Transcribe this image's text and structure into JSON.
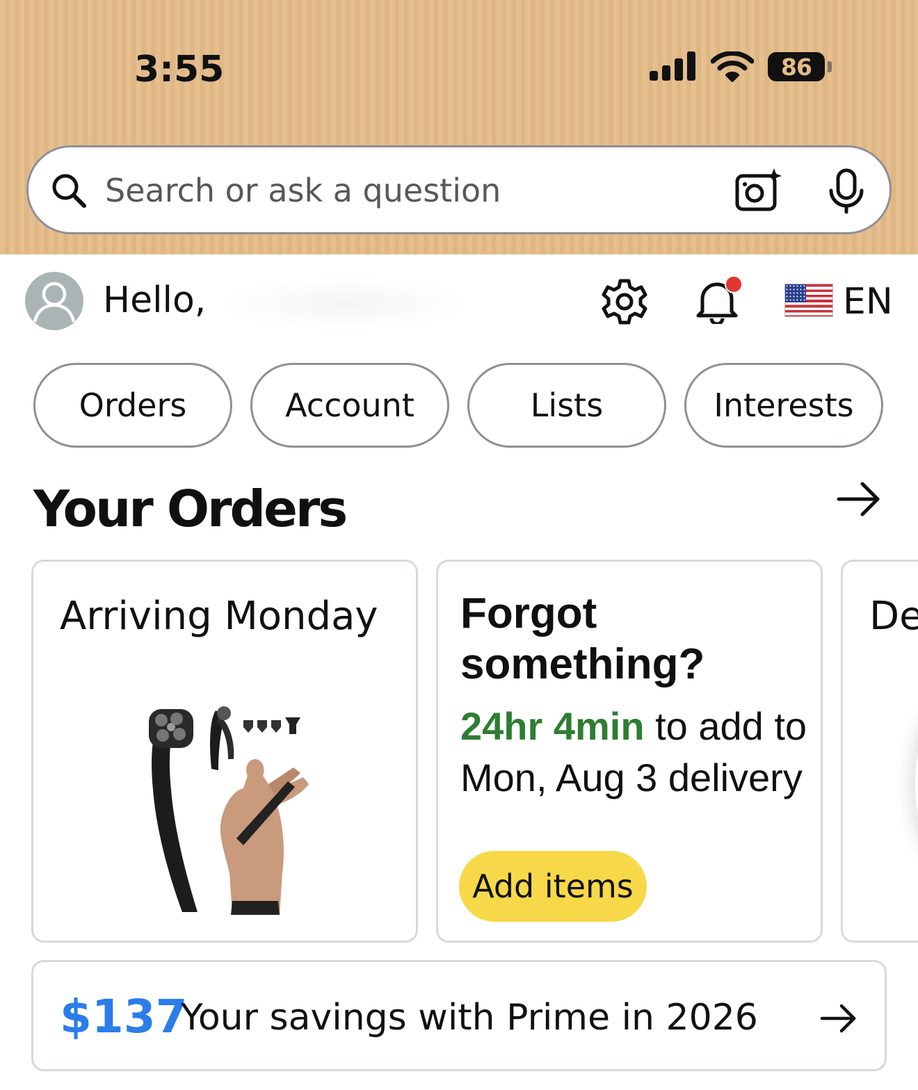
{
  "status_bar": {
    "time": "3:55",
    "battery": "86",
    "icons": [
      "cellular-signal-icon",
      "wifi-icon",
      "battery-icon"
    ]
  },
  "search": {
    "placeholder": "Search or ask a question",
    "icons": [
      "search-icon",
      "camera-lens-icon",
      "microphone-icon"
    ]
  },
  "greeting": {
    "hello": "Hello,",
    "language": "EN",
    "icons": [
      "avatar-icon",
      "gear-icon",
      "bell-icon",
      "us-flag-icon"
    ],
    "notification_dot_color": "#e3342f"
  },
  "quick_links": [
    "Orders",
    "Account",
    "Lists",
    "Interests"
  ],
  "orders": {
    "title": "Your Orders",
    "cards": [
      {
        "status": "Arriving Monday",
        "image": "back-shaver-product-image"
      },
      {
        "title": "Forgot something?",
        "timer": "24hr 4min",
        "text_after_timer": " to add to Mon, Aug 3 delivery",
        "button": "Add items"
      },
      {
        "status": "De"
      }
    ]
  },
  "savings": {
    "amount": "$137",
    "text": "Your savings with Prime in 2026"
  },
  "colors": {
    "header_bg": "#e4bb88",
    "accent_yellow": "#f7d848",
    "timer_green": "#2e7d32",
    "savings_blue": "#2b7de9"
  }
}
